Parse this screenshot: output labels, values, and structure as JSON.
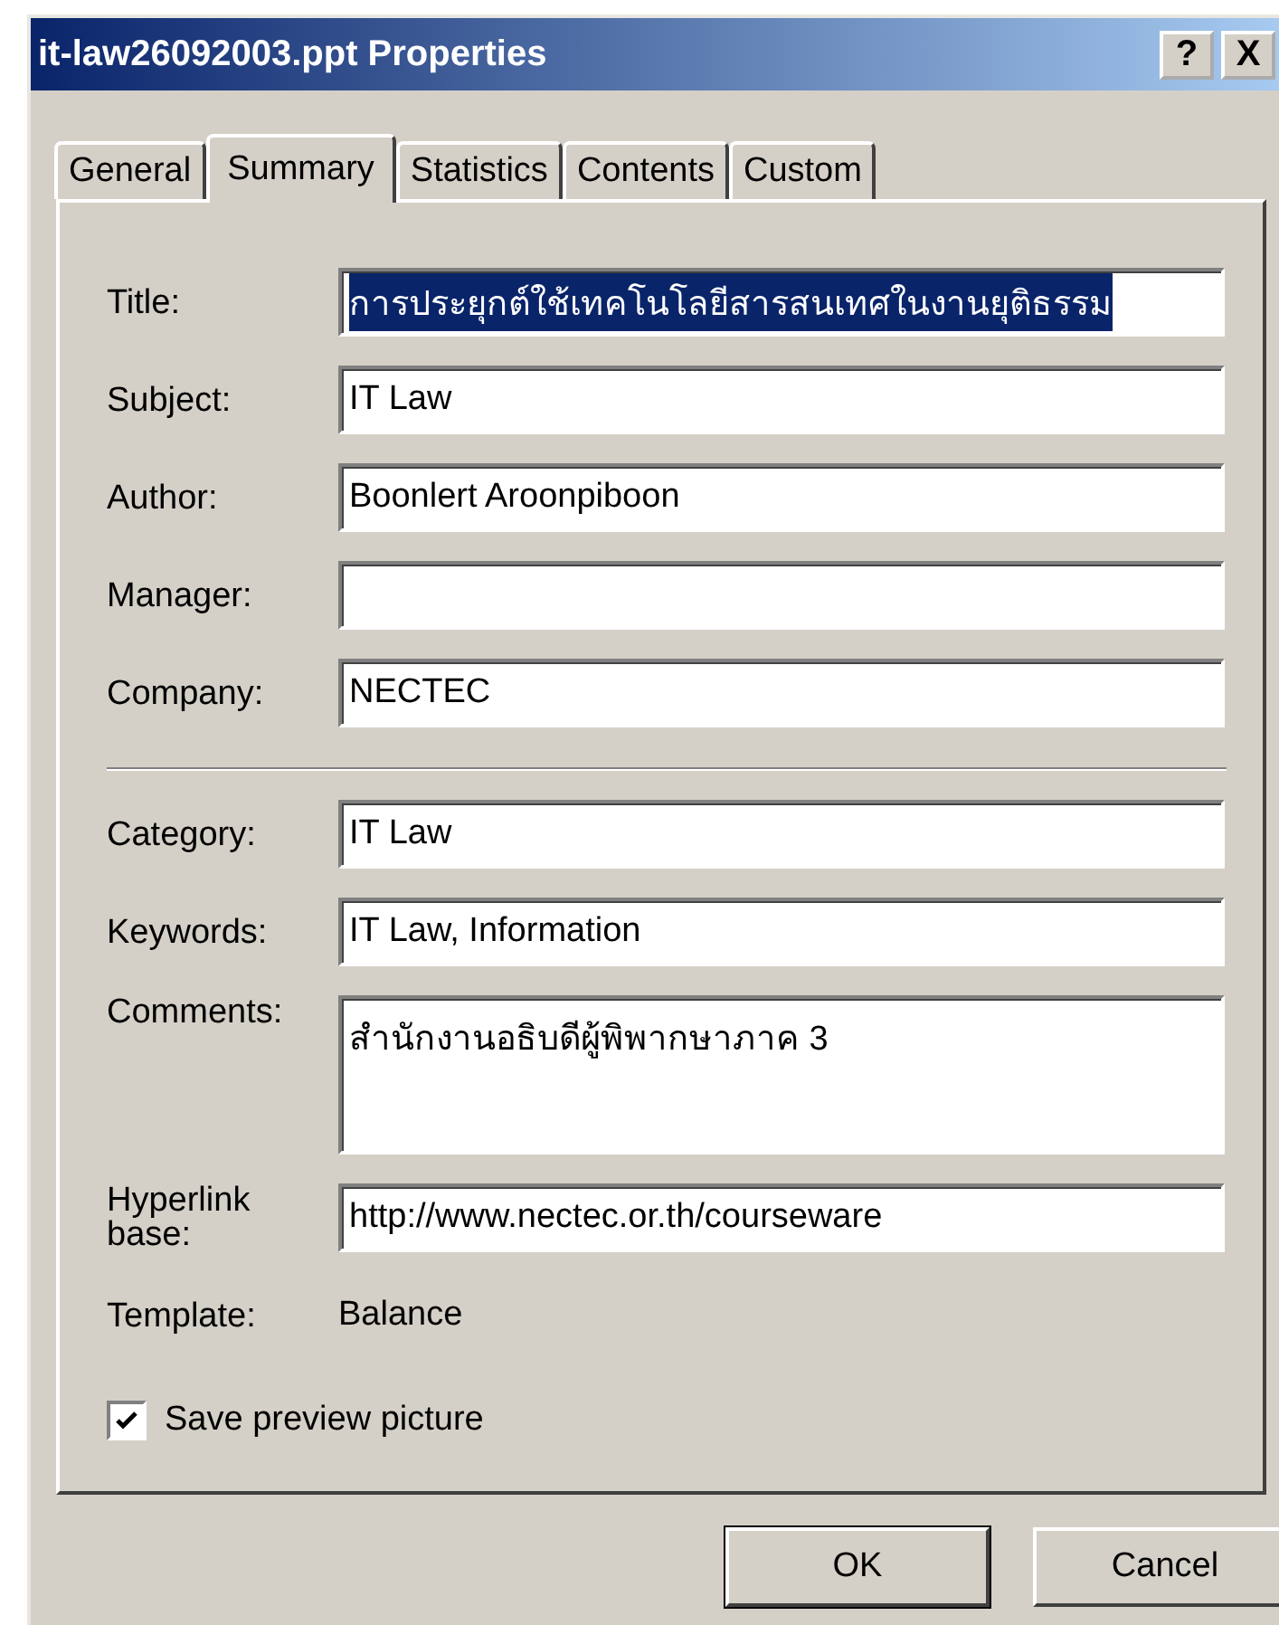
{
  "window": {
    "title": "it-law26092003.ppt Properties",
    "help_button": "?",
    "close_button": "X"
  },
  "tabs": [
    {
      "label": "General",
      "selected": false
    },
    {
      "label": "Summary",
      "selected": true
    },
    {
      "label": "Statistics",
      "selected": false
    },
    {
      "label": "Contents",
      "selected": false
    },
    {
      "label": "Custom",
      "selected": false
    }
  ],
  "fields_top": [
    {
      "label": "Title:",
      "value": "การประยุกต์ใช้เทคโนโลยีสารสนเทศในงานยุติธรรม",
      "text_selected": true
    },
    {
      "label": "Subject:",
      "value": "IT Law"
    },
    {
      "label": "Author:",
      "value": "Boonlert Aroonpiboon"
    },
    {
      "label": "Manager:"
    },
    {
      "label": "Company:",
      "value": "NECTEC"
    }
  ],
  "fields_bottom": [
    {
      "kind": "line",
      "label": "Category:",
      "value": "IT Law"
    },
    {
      "kind": "line",
      "label": "Keywords:",
      "value": "IT Law, Information"
    },
    {
      "kind": "multiline",
      "label": "Comments:",
      "value": "สำนักงานอธิบดีผู้พิพากษาภาค 3"
    },
    {
      "kind": "line",
      "label": "Hyperlink base:",
      "value": "http://www.nectec.or.th/courseware"
    }
  ],
  "template": {
    "label": "Template:",
    "value": "Balance"
  },
  "save_preview": {
    "label": "Save preview picture",
    "checked": true
  },
  "buttons": [
    {
      "label": "OK",
      "default": true
    },
    {
      "label": "Cancel",
      "default": false
    }
  ]
}
